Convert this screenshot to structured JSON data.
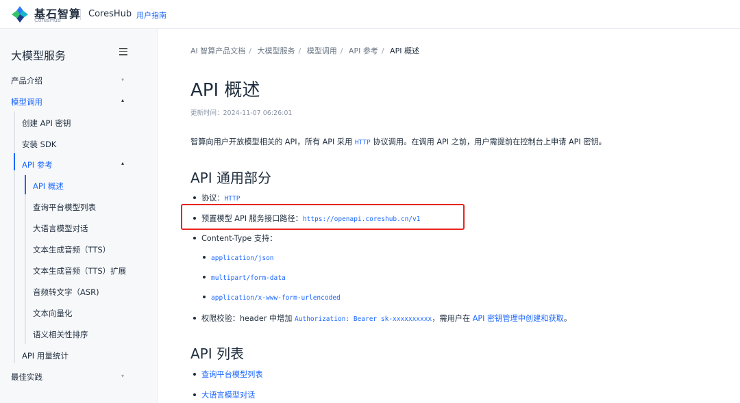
{
  "header": {
    "brand_title": "基石智算",
    "brand_sub": "CoresHub",
    "product": "CoresHub",
    "guide_link": "用户指南",
    "logo_icon": "coreshub-logo-icon"
  },
  "sidebar": {
    "title": "大模型服务",
    "menu_icon": "hamburger-menu-icon",
    "items": [
      {
        "label": "产品介绍"
      },
      {
        "label": "模型调用"
      },
      {
        "label": "创建 API 密钥"
      },
      {
        "label": "安装 SDK"
      },
      {
        "label": "API 参考"
      },
      {
        "label": "API 概述"
      },
      {
        "label": "查询平台模型列表"
      },
      {
        "label": "大语言模型对话"
      },
      {
        "label": "文本生成音频（TTS）"
      },
      {
        "label": "文本生成音频（TTS）扩展"
      },
      {
        "label": "音频转文字（ASR)"
      },
      {
        "label": "文本向量化"
      },
      {
        "label": "语义相关性排序"
      },
      {
        "label": "API 用量统计"
      },
      {
        "label": "最佳实践"
      }
    ]
  },
  "breadcrumb": {
    "items": [
      "AI 智算产品文档",
      "大模型服务",
      "模型调用",
      "API 参考",
      "API 概述"
    ],
    "separator": "/"
  },
  "content": {
    "title": "API 概述",
    "updated_label": "更新时间：",
    "updated_value": "2024-11-07 06:26:01",
    "intro_a": "智算向用户开放模型相关的 API，所有 API 采用 ",
    "intro_code": "HTTP",
    "intro_b": " 协议调用。在调用 API 之前，用户需提前在控制台上申请 API 密钥。",
    "section1_title": "API 通用部分",
    "protocol_label": "协议：",
    "protocol_value": "HTTP",
    "endpoint_label": "预置模型 API 服务接口路径：",
    "endpoint_value": "https://openapi.coreshub.cn/v1",
    "content_type_label": "Content-Type 支持：",
    "content_types": [
      "application/json",
      "multipart/form-data",
      "application/x-www-form-urlencoded"
    ],
    "auth_a": "权限校验：header 中增加 ",
    "auth_code": "Authorization: Bearer sk-xxxxxxxxxx",
    "auth_b": "，需用户在 ",
    "auth_link": "API 密钥管理中创建和获取",
    "auth_c": "。",
    "section2_title": "API 列表",
    "api_list": [
      "查询平台模型列表",
      "大语言模型对话"
    ]
  },
  "colors": {
    "accent": "#1a66ff",
    "highlight_box": "#e8241c"
  }
}
